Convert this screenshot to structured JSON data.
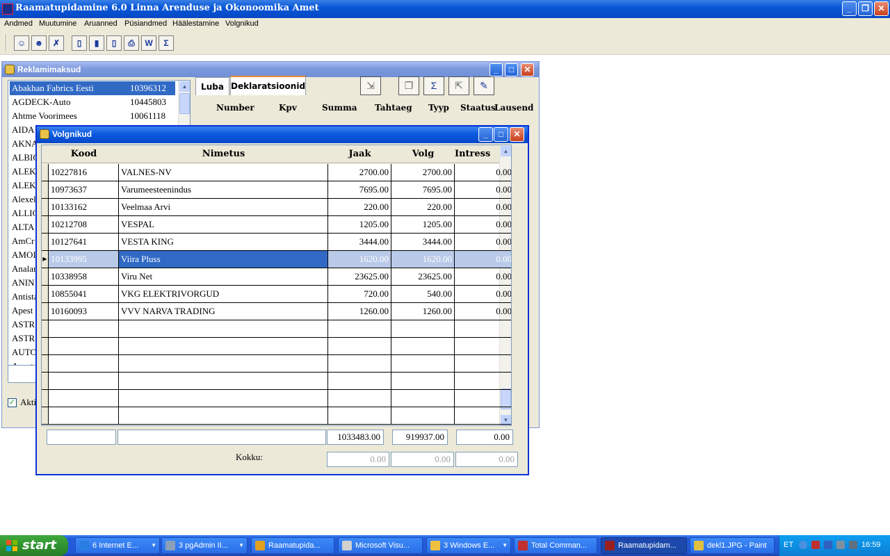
{
  "app": {
    "title": "Raamatupidamine 6.0 Linna Arenduse ja Okonoomika Amet",
    "menu": [
      "Andmed",
      "Muutumine",
      "Aruanned",
      "Püsiandmed",
      "Häälestamine",
      "Volgnikud"
    ]
  },
  "toolbar": {
    "icons": [
      "users-icon",
      "user-arrow-icon",
      "user-delete-icon",
      "new-doc-icon",
      "edit-doc-icon",
      "delete-doc-icon",
      "print-icon",
      "wolf-icon",
      "sum-icon"
    ]
  },
  "reklamimaksud": {
    "title": "Reklamimaksud",
    "list": [
      {
        "name": "Abakhan Fabrics Eesti",
        "code": "10396312"
      },
      {
        "name": "AGDECK-Auto",
        "code": "10445803"
      },
      {
        "name": "Ahtme Voorimees",
        "code": "10061118"
      },
      {
        "name": "AIDA",
        "code": ""
      },
      {
        "name": "AKNA",
        "code": ""
      },
      {
        "name": "ALBIO",
        "code": ""
      },
      {
        "name": "ALEK",
        "code": ""
      },
      {
        "name": "ALEK",
        "code": ""
      },
      {
        "name": "Alexel",
        "code": ""
      },
      {
        "name": "ALLIG",
        "code": ""
      },
      {
        "name": "ALTA",
        "code": ""
      },
      {
        "name": "AmCr",
        "code": ""
      },
      {
        "name": "AMOI",
        "code": ""
      },
      {
        "name": "Analar",
        "code": ""
      },
      {
        "name": "ANIN",
        "code": ""
      },
      {
        "name": "Antista",
        "code": ""
      },
      {
        "name": "Apest",
        "code": ""
      },
      {
        "name": "ASTR",
        "code": ""
      },
      {
        "name": "ASTR",
        "code": ""
      },
      {
        "name": "AUTO",
        "code": ""
      },
      {
        "name": "Avant",
        "code": ""
      }
    ],
    "tabs": [
      "Luba",
      "Deklaratsioonid"
    ],
    "columns": [
      "Number",
      "Kpv",
      "Summa",
      "Tahtaeg",
      "Tyyp",
      "Staatus",
      "Lausend"
    ],
    "checkbox_label": "Akti"
  },
  "volgnikud": {
    "title": "Volgnikud",
    "columns": {
      "kood": "Kood",
      "nimetus": "Nimetus",
      "jaak": "Jaak",
      "volg": "Volg",
      "intress": "Intress"
    },
    "rows": [
      {
        "kood": "10227816",
        "nimetus": "VALNES-NV",
        "jaak": "2700.00",
        "volg": "2700.00",
        "intress": "0.00"
      },
      {
        "kood": "10973637",
        "nimetus": "Varumeesteenindus",
        "jaak": "7695.00",
        "volg": "7695.00",
        "intress": "0.00"
      },
      {
        "kood": "10133162",
        "nimetus": "Veelmaa Arvi",
        "jaak": "220.00",
        "volg": "220.00",
        "intress": "0.00"
      },
      {
        "kood": "10212708",
        "nimetus": "VESPAL",
        "jaak": "1205.00",
        "volg": "1205.00",
        "intress": "0.00"
      },
      {
        "kood": "10127641",
        "nimetus": "VESTA KING",
        "jaak": "3444.00",
        "volg": "3444.00",
        "intress": "0.00"
      },
      {
        "kood": "10133995",
        "nimetus": "Viira Pluss",
        "jaak": "1620.00",
        "volg": "1620.00",
        "intress": "0.00",
        "selected": true
      },
      {
        "kood": "10338958",
        "nimetus": "Viru Net",
        "jaak": "23625.00",
        "volg": "23625.00",
        "intress": "0.00"
      },
      {
        "kood": "10855041",
        "nimetus": "VKG ELEKTRIVORGUD",
        "jaak": "720.00",
        "volg": "540.00",
        "intress": "0.00"
      },
      {
        "kood": "10160093",
        "nimetus": "VVV NARVA TRADING",
        "jaak": "1260.00",
        "volg": "1260.00",
        "intress": "0.00"
      }
    ],
    "empty_rows": 6,
    "totals": {
      "jaak": "1033483.00",
      "volg": "919937.00",
      "intress": "0.00"
    },
    "kokku_label": "Kokku:",
    "kokku": {
      "jaak": "0.00",
      "volg": "0.00",
      "intress": "0.00"
    }
  },
  "taskbar": {
    "start": "start",
    "tasks": [
      {
        "label": "6 Internet E...",
        "icon": "ie-icon",
        "color": "#2a7de1",
        "dropdown": true
      },
      {
        "label": "3 pgAdmin II...",
        "icon": "elephant-icon",
        "color": "#8aa0b8",
        "dropdown": true
      },
      {
        "label": "Raamatupida...",
        "icon": "app-icon",
        "color": "#e0a020",
        "dropdown": false
      },
      {
        "label": "Microsoft Visu...",
        "icon": "vs-icon",
        "color": "#d0d0d0",
        "dropdown": false
      },
      {
        "label": "3 Windows E...",
        "icon": "folder-icon",
        "color": "#f0c040",
        "dropdown": true
      },
      {
        "label": "Total Comman...",
        "icon": "floppy-icon",
        "color": "#c03030",
        "dropdown": false
      },
      {
        "label": "Raamatupidam...",
        "icon": "app-icon",
        "color": "#9a2020",
        "dropdown": false,
        "active": true
      },
      {
        "label": "dekl1.JPG - Paint",
        "icon": "paint-icon",
        "color": "#e0c040",
        "dropdown": false
      }
    ],
    "tray": {
      "lang": "ET",
      "clock": "16:59"
    }
  }
}
